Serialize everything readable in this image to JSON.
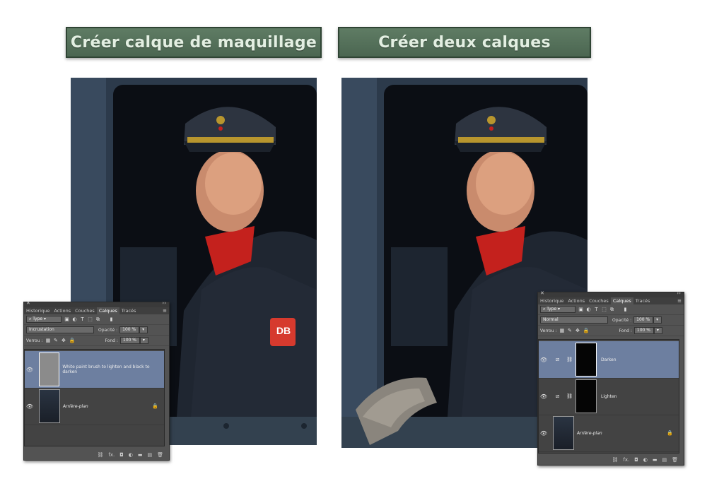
{
  "titles": {
    "left": "Créer calque de maquillage",
    "right": "Créer deux calques"
  },
  "photo_left": {
    "badge": "DB"
  },
  "panel_common": {
    "tabs": [
      "Historique",
      "Actions",
      "Couches",
      "Calques",
      "Tracés"
    ],
    "active_tab": "Calques",
    "filter": "Type",
    "opacity_label": "Opacité :",
    "opacity_value": "100 %",
    "lock_label": "Verrou :",
    "fill_label": "Fond :",
    "fill_value": "100 %",
    "footer_icons": [
      "link-icon",
      "fx-icon",
      "mask-icon",
      "adjustment-icon",
      "folder-icon",
      "new-layer-icon",
      "trash-icon"
    ],
    "fx_label": "fx."
  },
  "panel_left": {
    "blend_mode": "Incrustation",
    "layers": [
      {
        "name": "White paint brush to lighten and black to darken",
        "selected": true
      },
      {
        "name": "Arrière-plan",
        "selected": false,
        "locked": true
      }
    ]
  },
  "panel_right": {
    "blend_mode": "Normal",
    "layers": [
      {
        "name": "Darken",
        "selected": true
      },
      {
        "name": "Lighten",
        "selected": false
      },
      {
        "name": "Arrière-plan",
        "selected": false,
        "locked": true
      }
    ]
  },
  "colors": {
    "title_bg": "#55715b",
    "title_text": "#e3efe2",
    "panel_bg": "#535353",
    "selected_layer": "#6d7fa0"
  }
}
